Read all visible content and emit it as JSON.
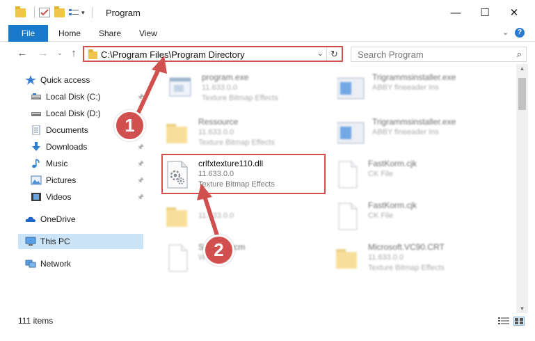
{
  "window": {
    "title": "Program",
    "minimize": "—",
    "maximize": "☐",
    "close": "✕"
  },
  "ribbon": {
    "tabs": [
      "File",
      "Home",
      "Share",
      "View"
    ],
    "expand": "⌄",
    "help": "?"
  },
  "nav": {
    "back": "←",
    "forward": "→",
    "recent": "⌄",
    "up": "↑"
  },
  "address": {
    "path": "C:\\Program Files\\Program Directory",
    "chevron": "⌄",
    "refresh": "↻"
  },
  "search": {
    "placeholder": "Search Program",
    "icon": "⌕"
  },
  "sidebar": {
    "items": [
      {
        "label": "Quick access",
        "icon": "star-icon",
        "pinned": false
      },
      {
        "label": "Local Disk (C:)",
        "icon": "drive-icon",
        "pinned": true
      },
      {
        "label": "Local Disk (D:)",
        "icon": "drive-icon",
        "pinned": false
      },
      {
        "label": "Documents",
        "icon": "documents-icon",
        "pinned": true
      },
      {
        "label": "Downloads",
        "icon": "download-icon",
        "pinned": true
      },
      {
        "label": "Music",
        "icon": "music-icon",
        "pinned": true
      },
      {
        "label": "Pictures",
        "icon": "pictures-icon",
        "pinned": true
      },
      {
        "label": "Videos",
        "icon": "videos-icon",
        "pinned": true
      },
      {
        "label": "OneDrive",
        "icon": "cloud-icon",
        "pinned": false
      },
      {
        "label": "This PC",
        "icon": "computer-icon",
        "pinned": false,
        "selected": true
      },
      {
        "label": "Network",
        "icon": "network-icon",
        "pinned": false
      }
    ],
    "pin_glyph": "📌"
  },
  "files": [
    {
      "name": "program.exe",
      "line2": "11.633.0.0",
      "line3": "Texture Bitmap Effects",
      "icon": "exe-icon",
      "blurred": true
    },
    {
      "name": "Trigrammsinstaller.exe",
      "line2": "ABBY fineeader Ins",
      "line3": "",
      "icon": "installer-icon",
      "blurred": true
    },
    {
      "name": "Ressource",
      "line2": "11.633.0.0",
      "line3": "Texture Bitmap Effects",
      "icon": "folder-icon",
      "blurred": true
    },
    {
      "name": "Trigrammsinstaller.exe",
      "line2": "ABBY fineeader Ins",
      "line3": "",
      "icon": "installer-icon",
      "blurred": true
    },
    {
      "name": "crlfxtexture110.dll",
      "line2": "11.633.0.0",
      "line3": "Texture Bitmap Effects",
      "icon": "dll-gear-icon",
      "blurred": false
    },
    {
      "name": "FastKorm.cjk",
      "line2": "CK File",
      "line3": "",
      "icon": "blank-file-icon",
      "blurred": true
    },
    {
      "name": "",
      "line2": "11.633.0.0",
      "line3": "",
      "icon": "folder-icon",
      "blurred": true
    },
    {
      "name": "FastKorm.cjk",
      "line2": "CK File",
      "line3": "",
      "icon": "blank-file-icon",
      "blurred": true
    },
    {
      "name": "Sn   P10.wcm",
      "line2": "W",
      "line3": "",
      "icon": "blank-file-icon",
      "blurred": true
    },
    {
      "name": "Microsoft.VC90.CRT",
      "line2": "11.633.0.0",
      "line3": "Texture Bitmap Effects",
      "icon": "folder-icon",
      "blurred": true
    }
  ],
  "status": {
    "count": "111 items"
  },
  "annotations": {
    "badge1": "1",
    "badge2": "2",
    "color": "#d24f4f"
  }
}
